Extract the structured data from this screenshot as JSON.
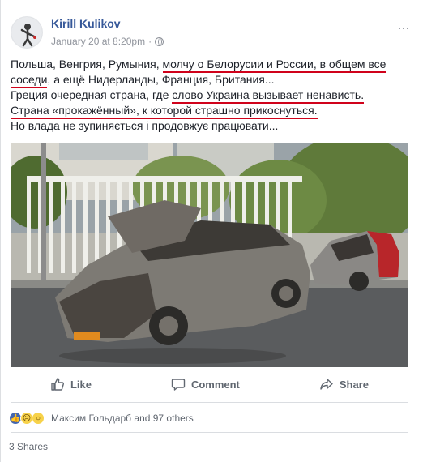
{
  "post": {
    "author": "Kirill Kulikov",
    "timestamp": "January 20 at 8:20pm",
    "separator": "·",
    "more_label": "···",
    "lines": [
      [
        "Польша, Венгрия, Румыния, ",
        "молчу о Белорусии и России, в общем все"
      ],
      [
        "соседи",
        ", а ещё Нидерланды, Франция, Британия..."
      ],
      [
        "Греция очередная страна, где ",
        "слово Украина вызывает ненависть."
      ],
      [
        "Страна «прокажённый», к которой страшно прикоснуться."
      ],
      [
        "Но влада не зупиняється і продовжує працювати..."
      ]
    ]
  },
  "actions": {
    "like": "Like",
    "comment": "Comment",
    "share": "Share"
  },
  "reactions": {
    "summary": "Максим Гольдарб and 97 others",
    "icons": [
      "like-reaction-icon",
      "sad-reaction-icon",
      "wow-reaction-icon"
    ]
  },
  "shares": "3 Shares",
  "colors": {
    "link": "#365899",
    "underline": "#d0021b",
    "meta": "#90949c"
  }
}
